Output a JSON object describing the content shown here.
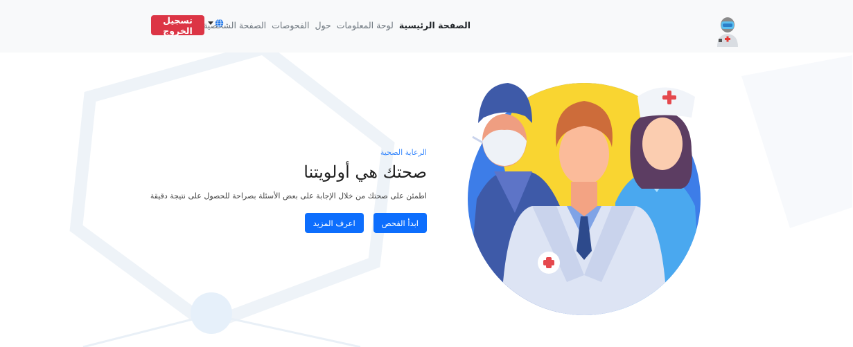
{
  "navbar": {
    "links": [
      {
        "label": "الصفحة الرئيسية",
        "active": true
      },
      {
        "label": "لوحة المعلومات",
        "active": false
      },
      {
        "label": "حول",
        "active": false
      },
      {
        "label": "الفحوصات",
        "active": false
      },
      {
        "label": "الصفحة الشخصية",
        "active": false
      }
    ],
    "logout_label": "تسجيل الخروج",
    "language_icon": "globe-icon",
    "logo_icon": "robot-doctor-icon"
  },
  "hero": {
    "eyebrow": "الرعاية الصحية",
    "headline": "صحتك هي أولويتنا",
    "subtitle": "اطمئن على صحتك من خلال الإجابة على بعض الأسئلة بصراحة للحصول على نتيجة دقيقة",
    "primary_cta": "ابدأ الفحص",
    "secondary_cta": "اعرف المزيد",
    "illustration_icon": "medical-staff-illustration"
  },
  "colors": {
    "primary": "#0d6efd",
    "danger": "#dc3545",
    "navbar_bg": "#f8f9fa",
    "illustration_circle": "#3d7de8",
    "illustration_sun": "#f9d531"
  }
}
